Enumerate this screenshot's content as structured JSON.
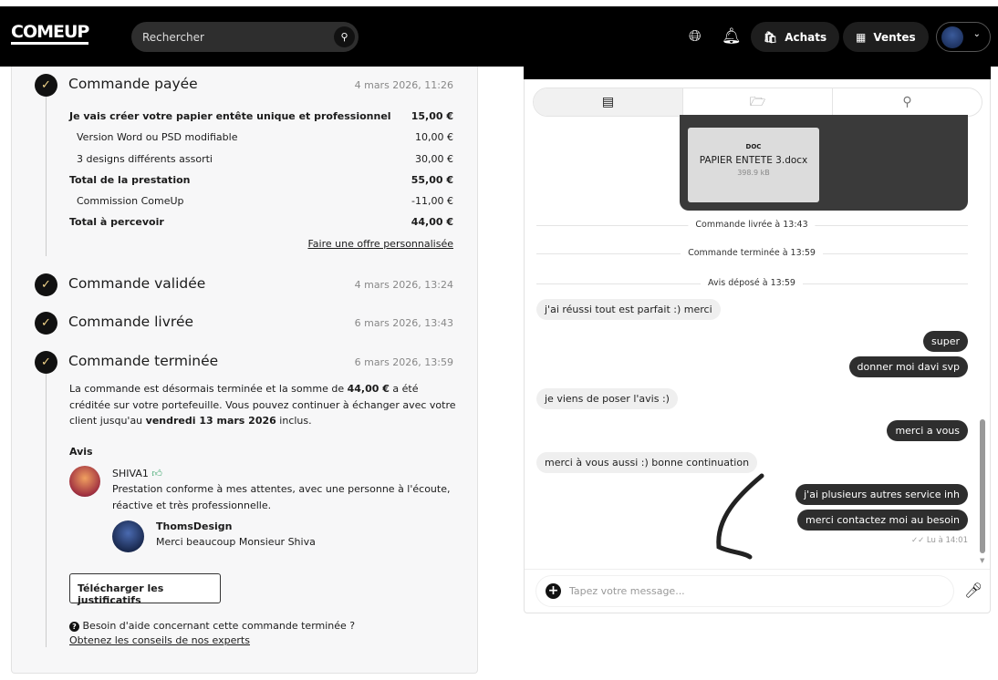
{
  "header": {
    "logo": "COMEUP",
    "search_placeholder": "Rechercher",
    "achats": "Achats",
    "ventes": "Ventes"
  },
  "order": {
    "steps": [
      {
        "title": "Commande payée",
        "date": "4 mars 2026, 11:26"
      },
      {
        "title": "Commande validée",
        "date": "4 mars 2026, 13:24"
      },
      {
        "title": "Commande livrée",
        "date": "6 mars 2026, 13:43"
      },
      {
        "title": "Commande terminée",
        "date": "6 mars 2026, 13:59"
      }
    ],
    "lines": [
      {
        "label": "Je vais créer votre papier entête unique et professionnel",
        "amount": "15,00 €"
      },
      {
        "label": "Version Word ou PSD modifiable",
        "amount": "10,00 €"
      },
      {
        "label": "3 designs différents assorti",
        "amount": "30,00 €"
      },
      {
        "label": "Total de la prestation",
        "amount": "55,00 €"
      },
      {
        "label": "Commission ComeUp",
        "amount": "-11,00 €"
      },
      {
        "label": "Total à percevoir",
        "amount": "44,00 €"
      }
    ],
    "custom_offer": "Faire une offre personnalisée",
    "done_text": {
      "p1": "La commande est désormais terminée et la somme de ",
      "amount": "44,00 €",
      "p2": " a été créditée sur votre portefeuille. Vous pouvez continuer à échanger avec votre client jusqu'au ",
      "date": "vendredi 13 mars 2026",
      "p3": " inclus."
    },
    "review": {
      "heading": "Avis",
      "author": "SHIVA1",
      "text": "Prestation conforme à mes attentes, avec une personne à l'écoute, réactive et très professionnelle.",
      "reply_author": "ThomsDesign",
      "reply_text": "Merci beaucoup Monsieur Shiva"
    },
    "download_btn": "Télécharger les justificatifs",
    "help_text": "Besoin d'aide concernant cette commande terminée ?",
    "help_link": "Obtenez les conseils de nos experts"
  },
  "chat": {
    "file": {
      "type": "DOC",
      "name": "PAPIER ENTETE 3.docx",
      "size": "398.9 kB"
    },
    "events": [
      "Commande livrée à 13:43",
      "Commande terminée à 13:59",
      "Avis déposé à 13:59"
    ],
    "messages": [
      {
        "dir": "in",
        "text": "j'ai réussi tout est parfait :) merci"
      },
      {
        "dir": "out",
        "text": "super"
      },
      {
        "dir": "out",
        "text": "donner moi davi svp"
      },
      {
        "dir": "in",
        "text": "je viens de poser l'avis :)"
      },
      {
        "dir": "out",
        "text": "merci a vous"
      },
      {
        "dir": "in",
        "text": "merci à vous aussi :) bonne continuation"
      },
      {
        "dir": "out",
        "text": "j'ai plusieurs autres service inh"
      },
      {
        "dir": "out",
        "text": "merci contactez moi au besoin"
      }
    ],
    "read_status": "Lu à 14:01",
    "input_placeholder": "Tapez votre message..."
  }
}
